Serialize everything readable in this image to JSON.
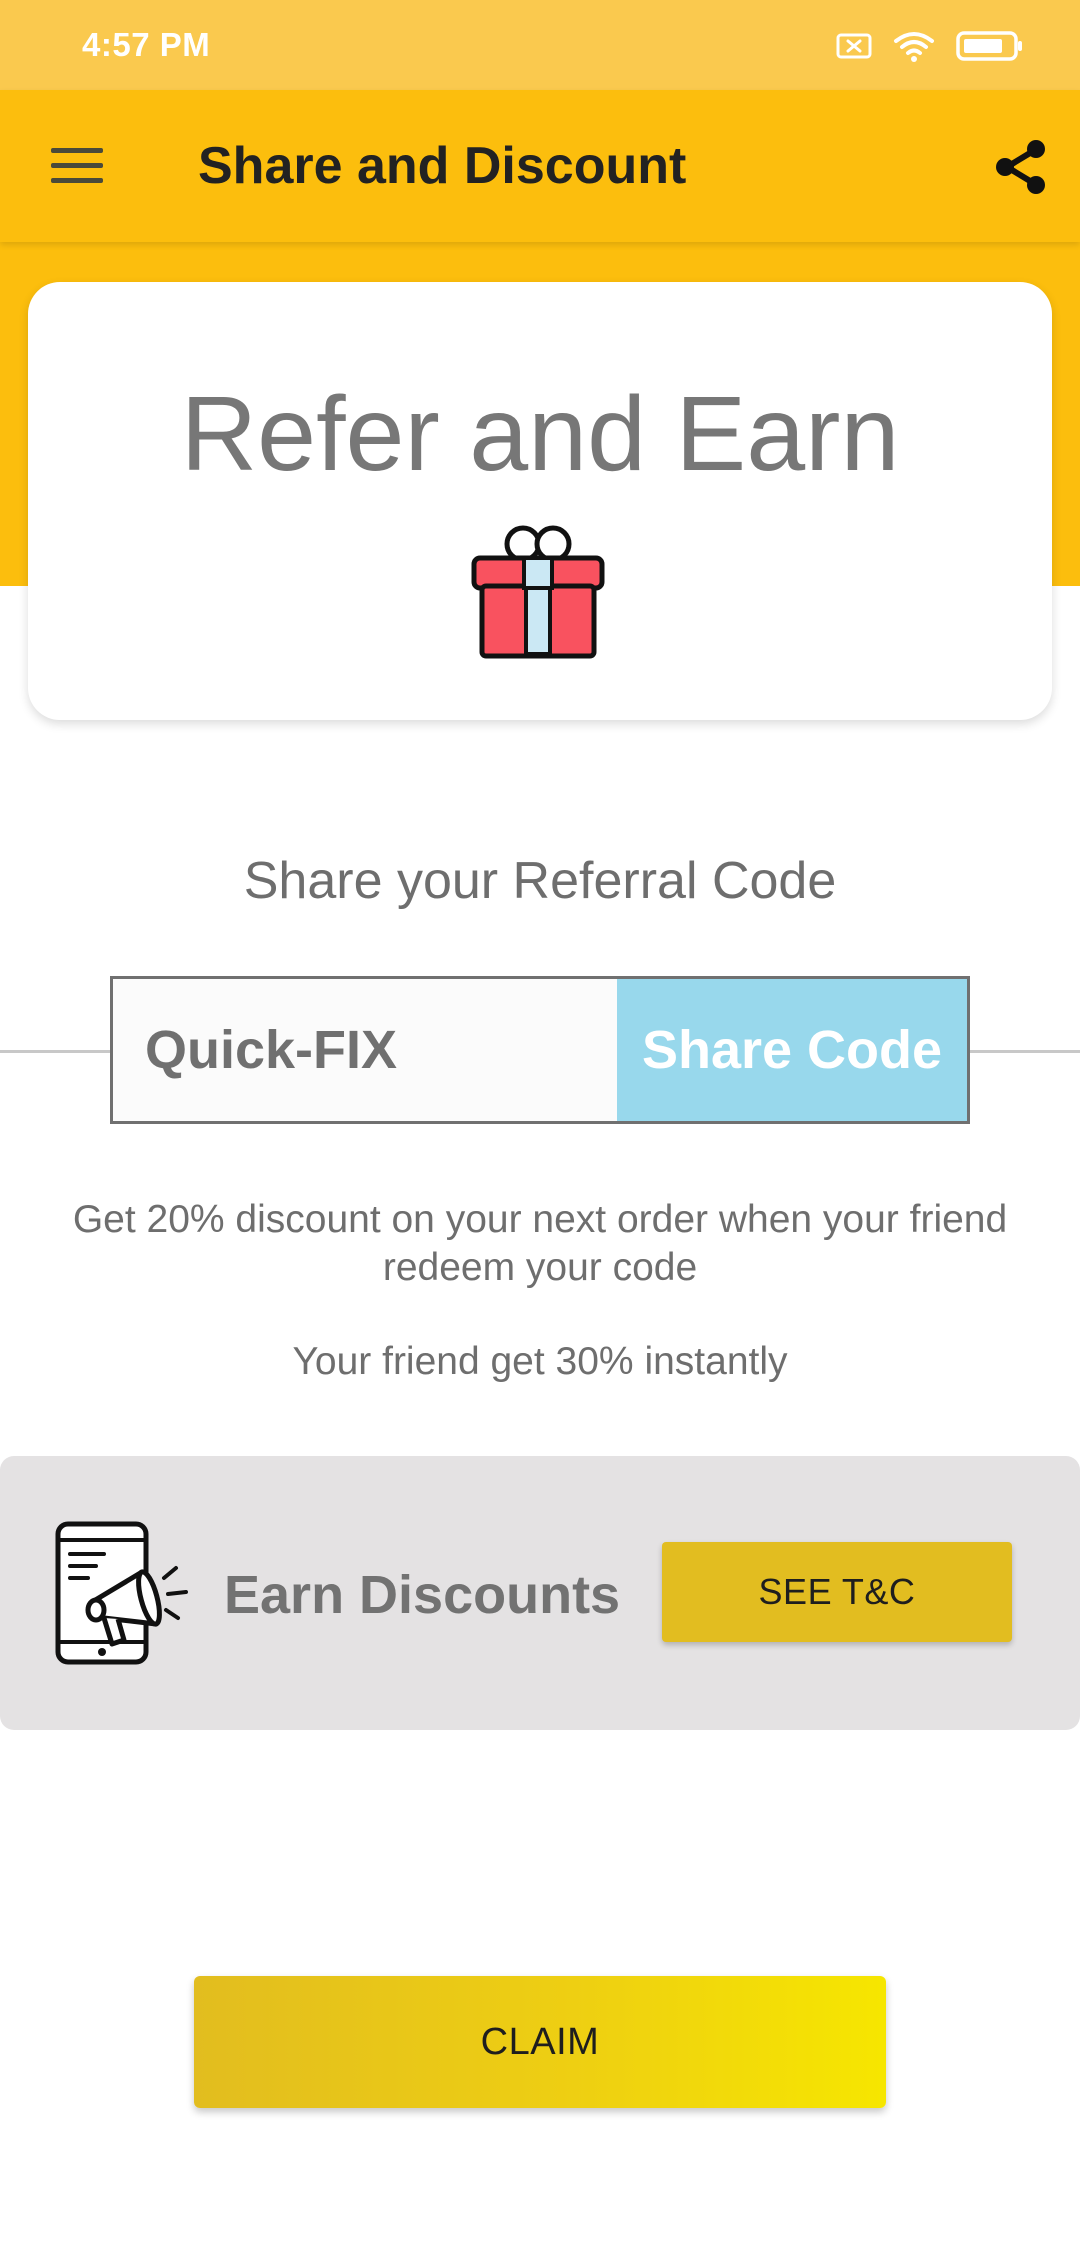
{
  "status_bar": {
    "time": "4:57 PM",
    "icons": [
      "sim-off-icon",
      "wifi-icon",
      "battery-icon"
    ]
  },
  "app_bar": {
    "title": "Share and Discount",
    "menu_icon": "hamburger-menu-icon",
    "share_icon": "share-icon"
  },
  "hero": {
    "title": "Refer and Earn",
    "icon": "gift-icon"
  },
  "referral": {
    "label": "Share your Referral Code",
    "code": "Quick-FIX",
    "share_button": "Share Code"
  },
  "description": {
    "discount": "Get 20% discount on your next order when your friend redeem your code",
    "friend": "Your friend get 30% instantly"
  },
  "earn_panel": {
    "label": "Earn Discounts",
    "icon": "megaphone-phone-icon",
    "tc_button": "SEE T&C"
  },
  "claim": {
    "label": "CLAIM"
  },
  "colors": {
    "primary_yellow": "#fcbe0d",
    "status_bar": "#fac94e",
    "share_code_bg": "#98d8ec",
    "panel_bg": "#e4e2e3",
    "button_gold": "#e2bd20",
    "gift_red": "#f9525f",
    "gift_ribbon": "#cbe8f4"
  }
}
